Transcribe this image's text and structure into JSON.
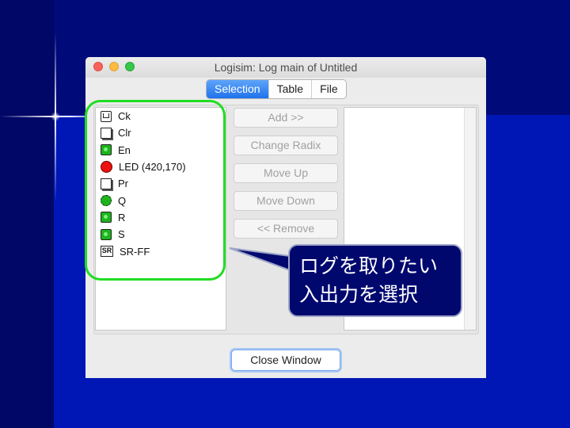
{
  "window": {
    "title": "Logisim: Log main of Untitled",
    "tabs": [
      {
        "label": "Selection",
        "active": true
      },
      {
        "label": "Table",
        "active": false
      },
      {
        "label": "File",
        "active": false
      }
    ]
  },
  "component_list": [
    {
      "label": "Ck",
      "icon": "clock-icon"
    },
    {
      "label": "Clr",
      "icon": "pin-icon"
    },
    {
      "label": "En",
      "icon": "input-pin-icon"
    },
    {
      "label": "LED (420,170)",
      "icon": "led-icon"
    },
    {
      "label": "Pr",
      "icon": "pin-icon"
    },
    {
      "label": "Q",
      "icon": "output-pin-icon"
    },
    {
      "label": "R",
      "icon": "input-pin-icon"
    },
    {
      "label": "S",
      "icon": "input-pin-icon"
    },
    {
      "label": "SR-FF",
      "icon": "sr-flipflop-icon",
      "badge": "SR"
    }
  ],
  "actions": {
    "add": "Add >>",
    "change_radix": "Change Radix",
    "move_up": "Move Up",
    "move_down": "Move Down",
    "remove": "<< Remove"
  },
  "close_button": "Close Window",
  "annotation": {
    "line1": "ログを取りたい",
    "line2": "入出力を選択",
    "highlight_color": "#22dd22"
  },
  "colors": {
    "background": "#000a78",
    "accent_tab": "#1f72ec"
  }
}
